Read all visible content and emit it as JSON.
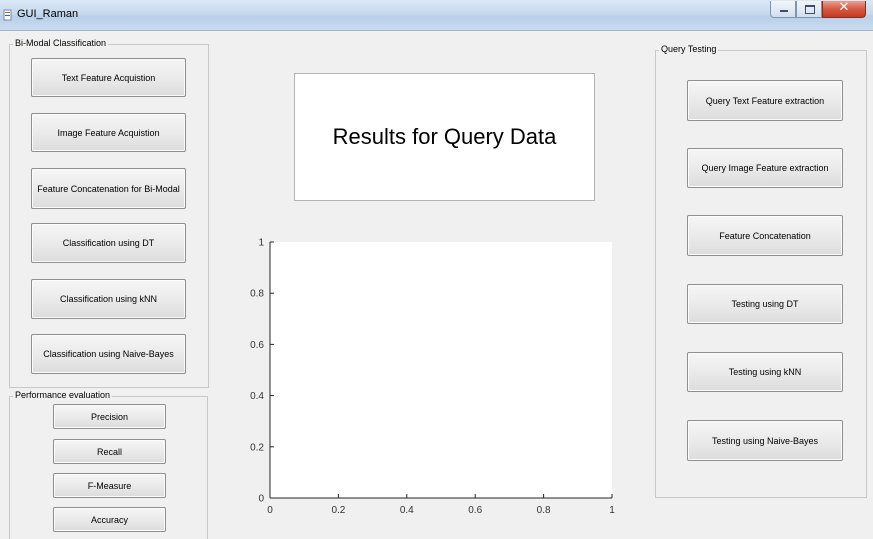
{
  "window": {
    "title": "GUI_Raman",
    "close_glyph": "✕"
  },
  "bimodal": {
    "title": "Bi-Modal Classification",
    "buttons": [
      "Text Feature Acquistion",
      "Image Feature Acquistion",
      "Feature Concatenation for Bi-Modal",
      "Classification using DT",
      "Classification using kNN",
      "Classification using Naive-Bayes"
    ]
  },
  "performance": {
    "title": "Performance evaluation",
    "buttons": [
      "Precision",
      "Recall",
      "F-Measure",
      "Accuracy"
    ]
  },
  "results": {
    "label": "Results for Query Data"
  },
  "query": {
    "title": "Query Testing",
    "buttons": [
      "Query Text Feature extraction",
      "Query Image Feature extraction",
      "Feature Concatenation",
      "Testing using DT",
      "Testing using kNN",
      "Testing using Naive-Bayes"
    ]
  },
  "chart_data": {
    "type": "line",
    "title": "",
    "xlabel": "",
    "ylabel": "",
    "xlim": [
      0,
      1
    ],
    "ylim": [
      0,
      1
    ],
    "x_ticks": [
      "0",
      "0.2",
      "0.4",
      "0.6",
      "0.8",
      "1"
    ],
    "y_ticks": [
      "0",
      "0.2",
      "0.4",
      "0.6",
      "0.8",
      "1"
    ],
    "series": [],
    "grid": false
  }
}
